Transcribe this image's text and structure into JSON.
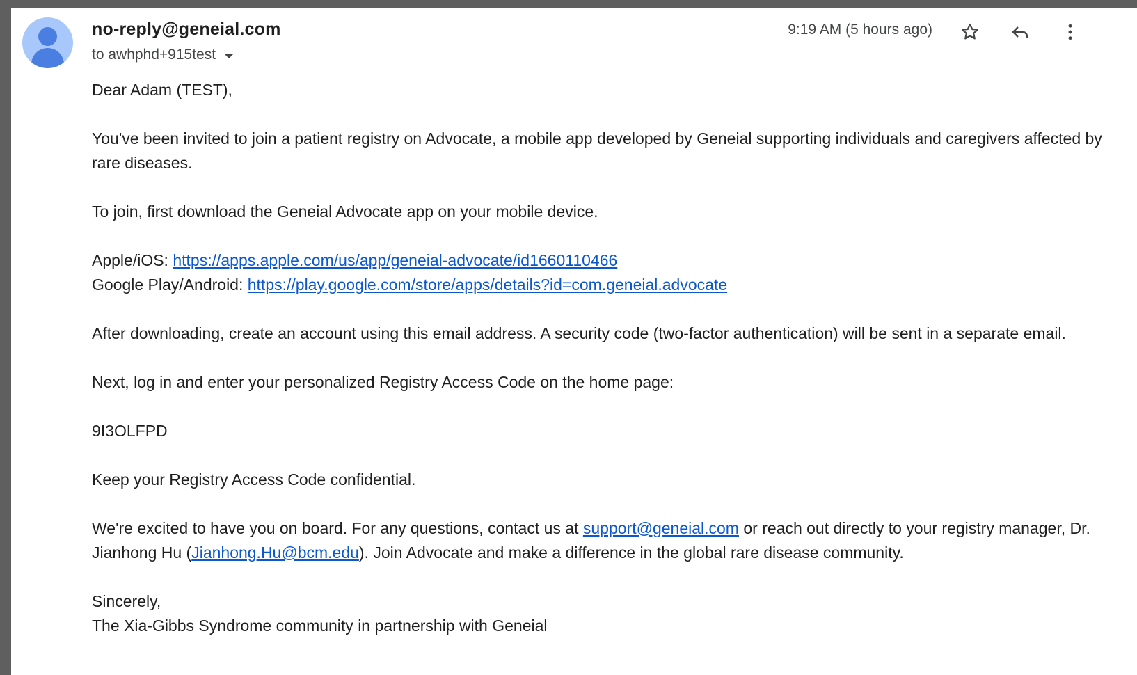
{
  "email": {
    "sender": "no-reply@geneial.com",
    "recipient": "to awhphd+915test",
    "timestamp": "9:19 AM (5 hours ago)",
    "icons": {
      "avatar": "avatar-icon",
      "recipient_dropdown": "chevron-down-icon",
      "star": "star-icon",
      "reply": "reply-icon",
      "more": "more-vert-icon"
    }
  },
  "message": {
    "greeting": "Dear Adam (TEST),",
    "invite_paragraph": "You've been invited to join a patient registry on Advocate, a mobile app developed by Geneial supporting individuals and caregivers affected by rare diseases.",
    "join_instruction": "To join, first download the Geneial Advocate app on your mobile device.",
    "ios_label": "Apple/iOS: ",
    "ios_link": "https://apps.apple.com/us/app/geneial-advocate/id1660110466",
    "android_label": "Google Play/Android: ",
    "android_link": "https://play.google.com/store/apps/details?id=com.geneial.advocate",
    "after_download": "After downloading, create an account using this email address. A security code (two-factor authentication) will be sent in a separate email.",
    "next_step": "Next, log in and enter your personalized Registry Access Code on the home page:",
    "access_code": "9I3OLFPD",
    "keep_confidential": "Keep your Registry Access Code confidential.",
    "contact_part1": "We're excited to have you on board. For any questions, contact us at ",
    "support_email": "support@geneial.com",
    "contact_part2": " or reach out directly to your registry manager, Dr. Jianhong Hu (",
    "manager_email": "Jianhong.Hu@bcm.edu",
    "contact_part3": "). Join Advocate and make a difference in the global rare disease community.",
    "closing": "Sincerely,",
    "signature": "The Xia-Gibbs Syndrome community in partnership with Geneial"
  },
  "colors": {
    "link": "#0b57d0",
    "text": "#1f1f1f",
    "secondary_text": "#444746",
    "avatar_bg": "#a8c7fa",
    "avatar_fg": "#4a7ee0"
  }
}
